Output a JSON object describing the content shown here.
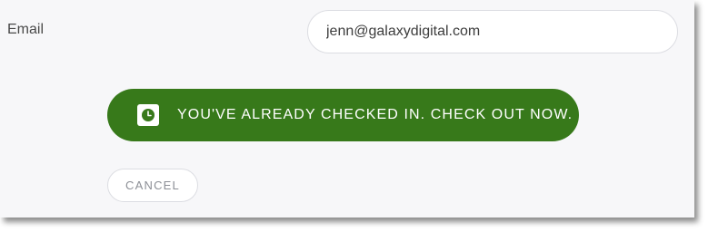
{
  "form": {
    "email_label": "Email",
    "email_value": "jenn@galaxydigital.com"
  },
  "checkout": {
    "label": "YOU'VE ALREADY CHECKED IN. CHECK OUT NOW.",
    "icon": "clock-icon"
  },
  "cancel": {
    "label": "CANCEL"
  },
  "colors": {
    "accent": "#37791a",
    "background": "#f7f7f9",
    "border": "#dcdde2"
  }
}
